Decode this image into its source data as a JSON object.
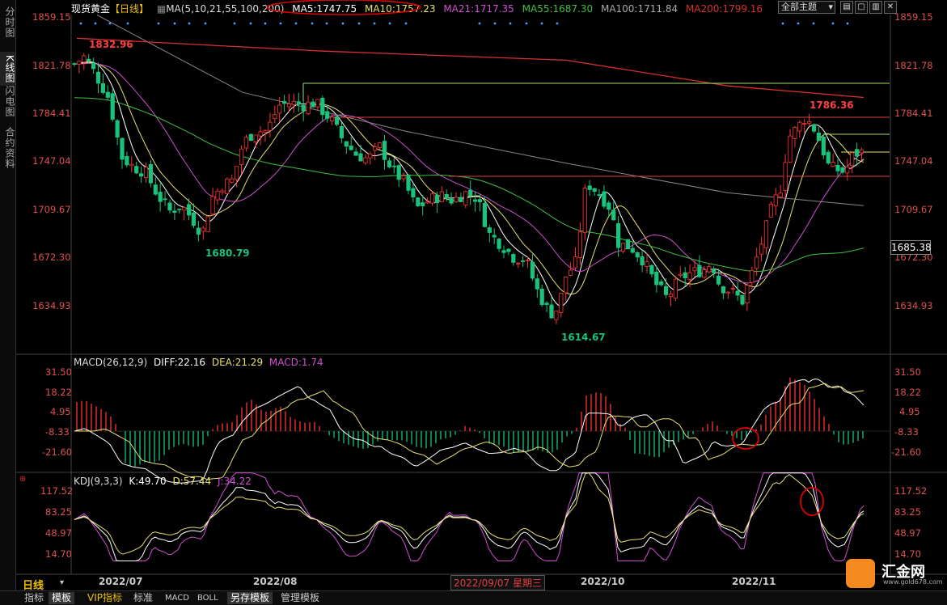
{
  "sidebar": [
    {
      "label": "分时图",
      "active": false
    },
    {
      "label": "K线图",
      "active": true
    },
    {
      "label": "闪电图",
      "active": false
    },
    {
      "label": "合约资料",
      "active": false
    }
  ],
  "header": {
    "title": "现货黄金",
    "period": "【日线】",
    "ma_def": "MA(5,10,21,55,100,200)",
    "ma5": "MA5:1747.75",
    "ma10": "MA10:1757.23",
    "ma21": "MA21:1717.35",
    "ma55": "MA55:1687.30",
    "ma100": "MA100:1711.84",
    "ma200": "MA200:1799.16",
    "dropdown": "全部主题"
  },
  "colors": {
    "up": "#ff3333",
    "down": "#19c37d",
    "ma5": "#ffffff",
    "ma10": "#e8e070",
    "ma21": "#d050d0",
    "ma55": "#40c040",
    "ma100": "#888888",
    "ma200": "#d83030",
    "kdj_k": "#ffffff",
    "kdj_d": "#e8e070",
    "kdj_j": "#d050d0"
  },
  "price_axis": [
    "1859.15",
    "1821.78",
    "1784.41",
    "1747.04",
    "1709.67",
    "1672.30",
    "1634.93"
  ],
  "annotations": {
    "high1": "1832.96",
    "low1": "1680.79",
    "high2": "1786.36",
    "low2": "1614.67",
    "current_price": "1685.38"
  },
  "macd": {
    "title": "MACD(26,12,9)",
    "diff": "DIFF:22.16",
    "dea": "DEA:21.29",
    "macd": "MACD:1.74",
    "axis": [
      "31.50",
      "18.22",
      "4.95",
      "-8.33",
      "-21.60"
    ]
  },
  "kdj": {
    "title": "KDJ(9,3,3)",
    "k": "K:49.70",
    "d": "D:57.44",
    "j": "J:34.22",
    "axis": [
      "117.52",
      "83.25",
      "48.97",
      "14.70"
    ]
  },
  "x_axis": [
    "2022/07",
    "2022/08",
    "2022/09/07 星期三",
    "2022/10",
    "2022/11"
  ],
  "period_label": "日线",
  "toolbar": [
    {
      "label": "指标",
      "selected": false
    },
    {
      "label": "模板",
      "selected": true
    },
    {
      "label": "VIP指标",
      "selected": false
    },
    {
      "label": "标准",
      "selected": false
    },
    {
      "label": "MACD",
      "selected": false
    },
    {
      "label": "BOLL",
      "selected": false
    },
    {
      "label": "另存模板",
      "selected": true
    },
    {
      "label": "管理模板",
      "selected": false
    }
  ],
  "logo": {
    "name": "汇金网",
    "url": "www.gold678.com"
  },
  "chart_data": {
    "type": "candlestick",
    "title": "现货黄金 【日线】",
    "ylim": [
      1600,
      1870
    ],
    "key_levels": {
      "high": 1832.96,
      "low1": 1680.79,
      "low2": 1614.67,
      "high2": 1786.36,
      "last": 1747.75
    },
    "macd_ylim": [
      -30,
      36
    ],
    "kdj_ylim": [
      0,
      125
    ]
  }
}
